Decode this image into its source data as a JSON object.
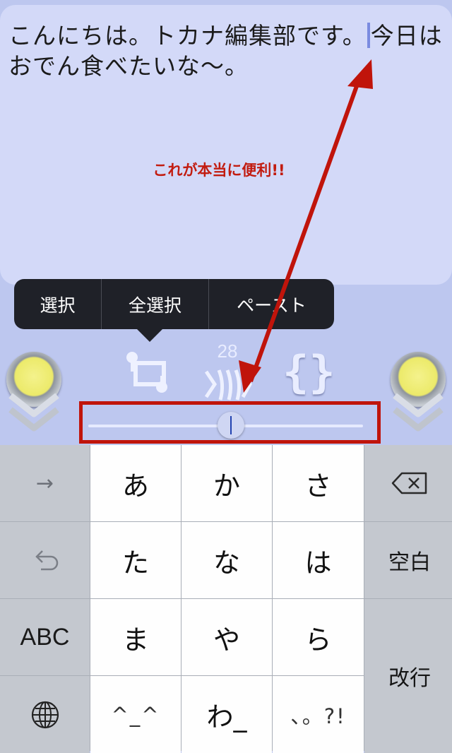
{
  "editor": {
    "text_before_cursor": "こんにちは。トカナ編集部です。",
    "text_after_cursor": "今日は\nおでん食べたいな〜。"
  },
  "annotation": {
    "text": "これが本当に便利!!",
    "color": "#c21c10"
  },
  "context_menu": {
    "items": [
      "選択",
      "全選択",
      "ペースト"
    ]
  },
  "toolbar": {
    "count": "28",
    "left_knob_icon": "yellow-knob-icon",
    "selection_icon": "selection-icon",
    "dash_icon": "dash-icon",
    "braces_icon": "braces-icon",
    "right_knob_icon": "yellow-knob-icon"
  },
  "cursor_slider": {
    "position_fraction": 0.52,
    "highlight_color": "#c0140b"
  },
  "keyboard": {
    "arrow_key": "→",
    "undo_key_icon": "undo-icon",
    "abc_key": "ABC",
    "globe_key_icon": "globe-icon",
    "backspace_key_icon": "backspace-icon",
    "space_key": "空白",
    "enter_key": "改行",
    "kana_keys": [
      "あ",
      "か",
      "さ",
      "た",
      "な",
      "は",
      "ま",
      "や",
      "ら",
      "^_^",
      "わ_",
      "、。?!"
    ]
  }
}
